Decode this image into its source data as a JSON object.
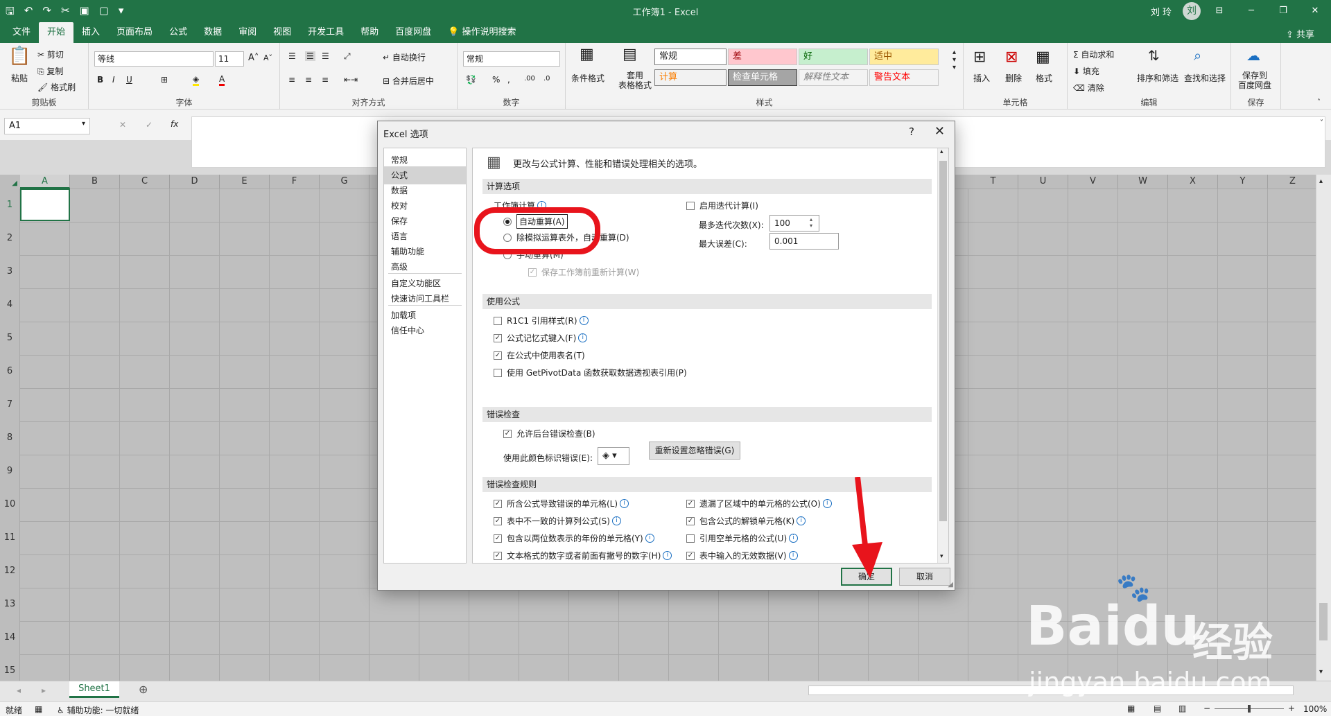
{
  "window": {
    "title": "工作簿1 - Excel",
    "user": "刘 玲",
    "avatar_letter": "刘"
  },
  "tabs": [
    "文件",
    "开始",
    "插入",
    "页面布局",
    "公式",
    "数据",
    "审阅",
    "视图",
    "开发工具",
    "帮助",
    "百度网盘",
    "操作说明搜索"
  ],
  "active_tab_index": 1,
  "share_label": "共享",
  "ribbon": {
    "clipboard": {
      "paste": "粘贴",
      "cut": "剪切",
      "copy": "复制",
      "format_painter": "格式刷",
      "label": "剪贴板"
    },
    "font": {
      "name": "等线",
      "size": "11",
      "label": "字体"
    },
    "align": {
      "wrap": "自动换行",
      "merge": "合并后居中",
      "label": "对齐方式"
    },
    "number": {
      "format": "常规",
      "label": "数字"
    },
    "styles": {
      "cond": "条件格式",
      "table": "套用\n表格格式",
      "label": "样式",
      "cells": [
        "常规",
        "差",
        "好",
        "适中",
        "计算",
        "检查单元格",
        "解释性文本",
        "警告文本"
      ]
    },
    "cells": {
      "insert": "插入",
      "delete": "删除",
      "format": "格式",
      "label": "单元格"
    },
    "edit": {
      "autosum": "自动求和",
      "fill": "填充",
      "clear": "清除",
      "sort": "排序和筛选",
      "find": "查找和选择",
      "label": "编辑"
    },
    "save": {
      "save": "保存到\n百度网盘",
      "label": "保存"
    }
  },
  "namebox": "A1",
  "columns": [
    "A",
    "B",
    "C",
    "D",
    "E",
    "F",
    "G",
    "T",
    "U",
    "V",
    "W",
    "X",
    "Y",
    "Z"
  ],
  "rows": [
    "1",
    "2",
    "3",
    "4",
    "5",
    "6",
    "7",
    "8",
    "9",
    "10",
    "11",
    "12",
    "13",
    "14",
    "15"
  ],
  "sheet_tab": "Sheet1",
  "status": {
    "ready": "就绪",
    "accessibility": "辅助功能: 一切就绪",
    "zoom": "100%"
  },
  "dialog": {
    "title": "Excel 选项",
    "help": "?",
    "nav": [
      "常规",
      "公式",
      "数据",
      "校对",
      "保存",
      "语言",
      "辅助功能",
      "高级",
      "自定义功能区",
      "快速访问工具栏",
      "加载项",
      "信任中心"
    ],
    "selected_nav": 1,
    "header": "更改与公式计算、性能和错误处理相关的选项。",
    "sections": {
      "calc": "计算选项",
      "formulas": "使用公式",
      "errcheck": "错误检查",
      "errrules": "错误检查规则"
    },
    "calc": {
      "workbook_label": "工作簿计算",
      "auto": "自动重算(A)",
      "auto_except": "除模拟运算表外，自动重算(D)",
      "manual": "手动重算(M)",
      "recalc_before_save": "保存工作簿前重新计算(W)",
      "iterative": "启用迭代计算(I)",
      "max_iter_label": "最多迭代次数(X):",
      "max_iter": "100",
      "max_change_label": "最大误差(C):",
      "max_change": "0.001"
    },
    "formulas": [
      "R1C1 引用样式(R)",
      "公式记忆式键入(F)",
      "在公式中使用表名(T)",
      "使用 GetPivotData 函数获取数据透视表引用(P)"
    ],
    "formulas_checked": [
      false,
      true,
      true,
      false
    ],
    "errcheck": {
      "background": "允许后台错误检查(B)",
      "color_label": "使用此颜色标识错误(E):",
      "reset": "重新设置忽略错误(G)"
    },
    "rules_left": [
      "所含公式导致错误的单元格(L)",
      "表中不一致的计算列公式(S)",
      "包含以两位数表示的年份的单元格(Y)",
      "文本格式的数字或者前面有撇号的数字(H)"
    ],
    "rules_right": [
      "遗漏了区域中的单元格的公式(O)",
      "包含公式的解锁单元格(K)",
      "引用空单元格的公式(U)",
      "表中输入的无效数据(V)"
    ],
    "rules_right_checked": [
      true,
      true,
      false,
      true
    ],
    "ok": "确定",
    "cancel": "取消"
  },
  "watermark": {
    "brand": "Bai",
    "brand2": "du",
    "cn": "经验",
    "url": "jingyan.baidu.com"
  }
}
